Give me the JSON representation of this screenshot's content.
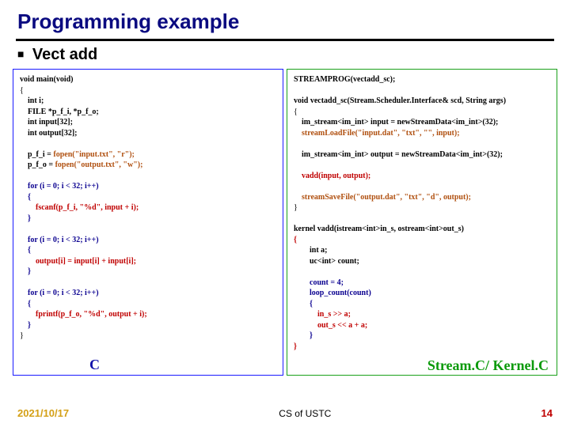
{
  "title": "Programming example",
  "bullet": {
    "sym": "■",
    "text": "Vect add"
  },
  "left_label": "C",
  "right_label": "Stream.C/\nKernel.C",
  "left_code": {
    "l01": "void main(void)",
    "l02": "{",
    "l03": "    int i;",
    "l04": "    FILE *p_f_i, *p_f_o;",
    "l05": "    int input[32];",
    "l06": "    int output[32];",
    "l07": "",
    "l08a": "    p_f_i = ",
    "l08b": "fopen(\"input.txt\", \"r\");",
    "l09a": "    p_f_o = ",
    "l09b": "fopen(\"output.txt\", \"w\");",
    "l10": "",
    "l11": "    for (i = 0; i < 32; i++)",
    "l12": "    {",
    "l13": "        fscanf(p_f_i, \"%d\", input + i);",
    "l14": "    }",
    "l15": "",
    "l16": "    for (i = 0; i < 32; i++)",
    "l17": "    {",
    "l18": "        output[i] = input[i] + input[i];",
    "l19": "    }",
    "l20": "",
    "l21": "    for (i = 0; i < 32; i++)",
    "l22": "    {",
    "l23": "        fprintf(p_f_o, \"%d\", output + i);",
    "l24": "    }",
    "l25": "}"
  },
  "right_code": {
    "r01": "STREAMPROG(vectadd_sc);",
    "r02": "",
    "r03": "void vectadd_sc(Stream.Scheduler.Interface& scd, String args)",
    "r04": "{",
    "r05": "    im_stream<im_int> input = newStreamData<im_int>(32);",
    "r06a": "    ",
    "r06b": "streamLoadFile(\"input.dat\", \"txt\", \"\", input);",
    "r07": "",
    "r08": "    im_stream<im_int> output = newStreamData<im_int>(32);",
    "r09": "",
    "r10": "    vadd(input, output);",
    "r11": "",
    "r12a": "    ",
    "r12b": "streamSaveFile(\"output.dat\", \"txt\", \"d\", output);",
    "r13": "}",
    "r14": "",
    "r15": "kernel vadd(istream<int>in_s, ostream<int>out_s)",
    "r16": "{",
    "r17": "        int a;",
    "r18": "        uc<int> count;",
    "r19": "",
    "r20": "        count = 4;",
    "r21": "        loop_count(count)",
    "r22": "        {",
    "r23": "            in_s >> a;",
    "r24": "            out_s << a + a;",
    "r25": "        }",
    "r26": "}"
  },
  "footer": {
    "date": "2021/10/17",
    "center": "CS of USTC",
    "page": "14"
  }
}
